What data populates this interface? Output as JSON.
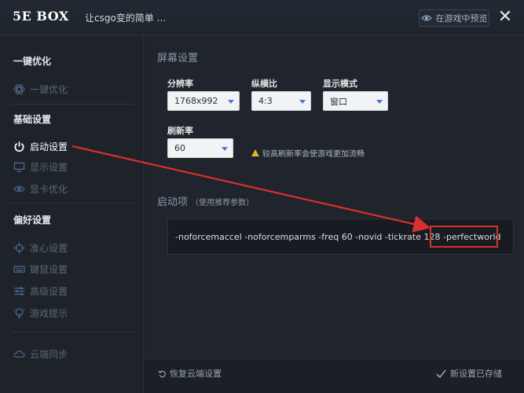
{
  "titlebar": {
    "logo": "5E BOX",
    "title": "让csgo变的简单 ...",
    "preview_label": "在游戏中预览",
    "close_glyph": "✕"
  },
  "sidebar": {
    "sections": [
      {
        "label": "一键优化"
      },
      {
        "label": "基础设置"
      },
      {
        "label": "偏好设置"
      }
    ],
    "items": [
      {
        "label": "一键优化",
        "icon": "atom-icon"
      },
      {
        "label": "启动设置",
        "icon": "power-icon",
        "active": true
      },
      {
        "label": "显示设置",
        "icon": "monitor-icon"
      },
      {
        "label": "显卡优化",
        "icon": "eye-icon"
      },
      {
        "label": "准心设置",
        "icon": "crosshair-icon"
      },
      {
        "label": "键鼠设置",
        "icon": "keyboard-icon"
      },
      {
        "label": "高级设置",
        "icon": "sliders-icon"
      },
      {
        "label": "游戏提示",
        "icon": "bulb-icon"
      },
      {
        "label": "云端同步",
        "icon": "cloud-icon"
      }
    ]
  },
  "screen": {
    "title": "屏幕设置",
    "resolution": {
      "label": "分辨率",
      "value": "1768x992"
    },
    "aspect": {
      "label": "纵横比",
      "value": "4:3"
    },
    "display_mode": {
      "label": "显示模式",
      "value": "窗口"
    },
    "refresh": {
      "label": "刷新率",
      "value": "60"
    },
    "warning": "较高刷新率会使游戏更加流畅"
  },
  "launch": {
    "title": "启动项",
    "note": "（使用推荐参数）",
    "options_text": "-noforcemaccel -noforcemparms -freq 60 -novid -tickrate 128 -perfectworld"
  },
  "footer": {
    "restore_label": "恢复云端设置",
    "saved_label": "新设置已存储"
  },
  "colors": {
    "accent": "#3b7ed6",
    "annotation_red": "#d9302c",
    "warning": "#e6b422"
  }
}
